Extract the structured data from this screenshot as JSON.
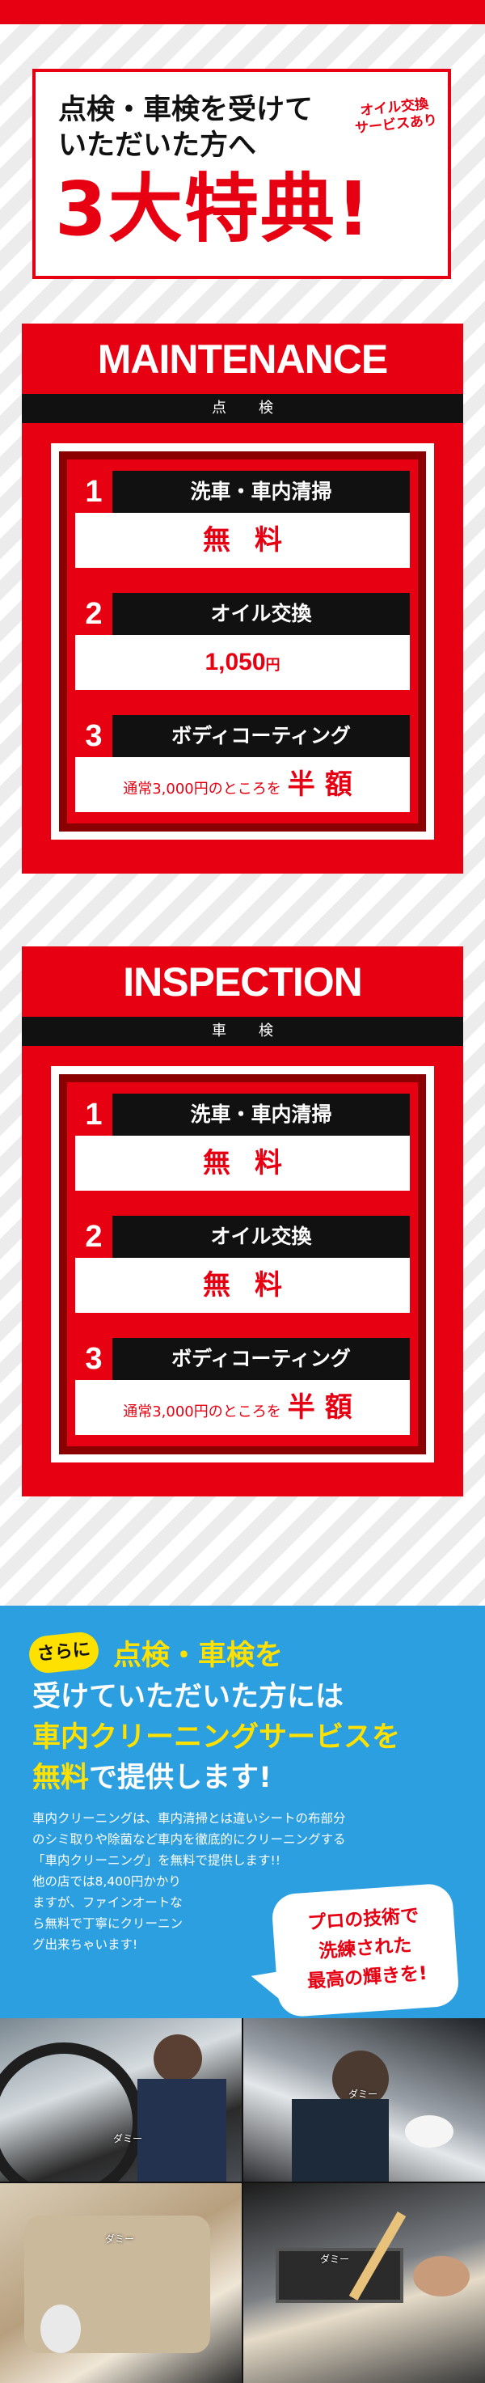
{
  "hero": {
    "line1": "点検・車検を受けて",
    "line2": "いただいた方へ",
    "big": "3大特典!",
    "oil_note": [
      "オイル交換",
      "サービスあり"
    ]
  },
  "maintenance": {
    "title": "MAINTENANCE",
    "subtitle": "点検",
    "items": [
      {
        "num": "1",
        "label": "洗車・車内清掃",
        "value": "無料"
      },
      {
        "num": "2",
        "label": "オイル交換",
        "value": "1,050",
        "unit": "円"
      },
      {
        "num": "3",
        "label": "ボディコーティング",
        "pre": "通常3,000円のところを",
        "value": "半額"
      }
    ]
  },
  "inspection": {
    "title": "INSPECTION",
    "subtitle": "車検",
    "items": [
      {
        "num": "1",
        "label": "洗車・車内清掃",
        "value": "無料"
      },
      {
        "num": "2",
        "label": "オイル交換",
        "value": "無料"
      },
      {
        "num": "3",
        "label": "ボディコーティング",
        "pre": "通常3,000円のところを",
        "value": "半額"
      }
    ]
  },
  "cleaning": {
    "badge": "さらに",
    "h1": "点検・車検を",
    "h2": "受けていただいた方には",
    "h3": "車内クリーニングサービスを",
    "h4a": "無料",
    "h4b": "で提供します!",
    "p1": "車内クリーニングは、車内清掃とは違いシートの布部分",
    "p2": "のシミ取りや除菌など車内を徹底的にクリーニングする",
    "p3": "「車内クリーニング」を無料で提供します!!",
    "p4": "他の店では8,400円かかり",
    "p5": "ますが、ファインオートな",
    "p6": "ら無料で丁寧にクリーニン",
    "p7": "グ出来ちゃいます!",
    "callout": [
      "プロの技術で",
      "洗練された",
      "最高の輝きを!"
    ]
  },
  "photos": {
    "dummy_label": "ダミー"
  },
  "colors": {
    "red": "#e60012",
    "dark_red": "#8b0000",
    "blue": "#2b9fe0",
    "yellow": "#ffe100"
  }
}
